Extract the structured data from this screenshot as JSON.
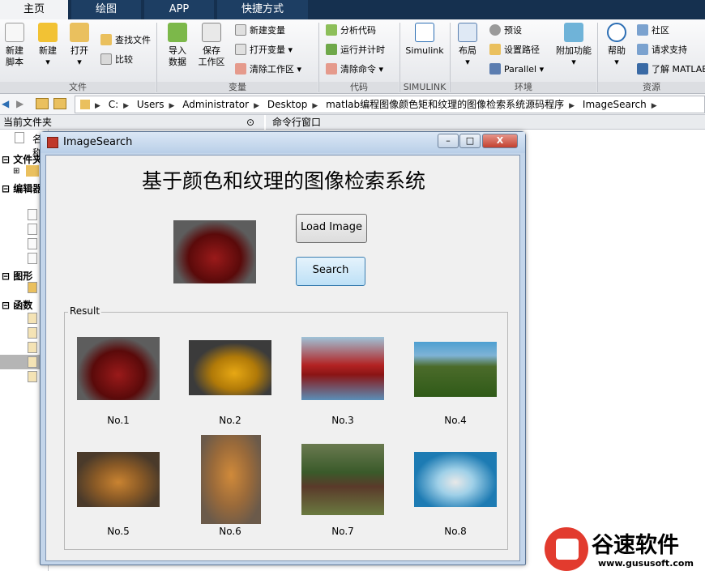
{
  "tabs": [
    "主页",
    "绘图",
    "APP",
    "快捷方式"
  ],
  "ribbon": {
    "new_script": "新建\n脚本",
    "new": "新建",
    "open": "打开",
    "find_files": "查找文件",
    "compare": "比较",
    "import": "导入\n数据",
    "save_ws": "保存\n工作区",
    "new_var": "新建变量",
    "open_var": "打开变量",
    "clear_ws": "清除工作区",
    "analyze": "分析代码",
    "run_time": "运行并计时",
    "clear_cmd": "清除命令",
    "simulink": "Simulink",
    "layout": "布局",
    "prefs": "预设",
    "set_path": "设置路径",
    "parallel": "Parallel",
    "addons": "附加功能",
    "help": "帮助",
    "community": "社区",
    "support": "请求支持",
    "learn": "了解 MATLAB",
    "groups": [
      "文件",
      "变量",
      "代码",
      "SIMULINK",
      "环境",
      "资源"
    ]
  },
  "address": {
    "crumbs": [
      "C:",
      "Users",
      "Administrator",
      "Desktop",
      "matlab编程图像颜色矩和纹理的图像检索系统源码程序",
      "ImageSearch"
    ]
  },
  "panels": {
    "current_folder": "当前文件夹",
    "command_window": "命令行窗口",
    "name_col": "名称"
  },
  "left_tree": [
    "文件夹",
    "编辑器",
    "图形",
    "函数"
  ],
  "window": {
    "title": "ImageSearch",
    "close": "X"
  },
  "app": {
    "heading": "基于颜色和纹理的图像检索系统",
    "load_label": "Load Image",
    "search_label": "Search",
    "result_label": "Result",
    "captions": [
      "No.1",
      "No.2",
      "No.3",
      "No.4",
      "No.5",
      "No.6",
      "No.7",
      "No.8"
    ]
  },
  "watermark": {
    "brand": "谷速软件",
    "url": "www.gususoft.com"
  }
}
